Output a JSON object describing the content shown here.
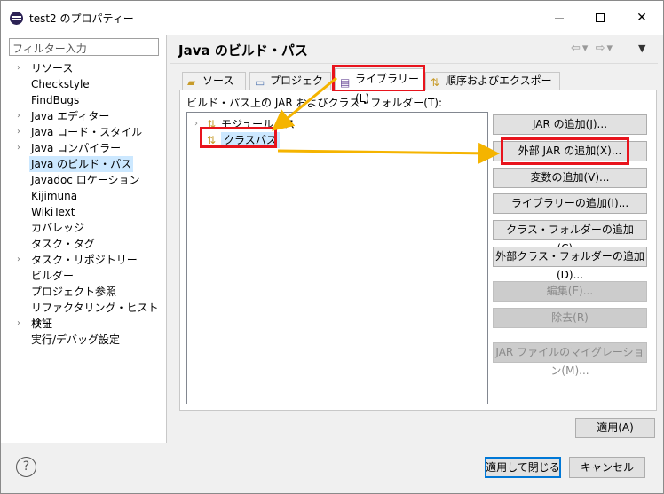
{
  "window": {
    "title": "test2 のプロパティー"
  },
  "filter": {
    "placeholder": "フィルター入力"
  },
  "sidebar": {
    "items": [
      {
        "label": "リソース",
        "expandable": true
      },
      {
        "label": "Checkstyle",
        "expandable": false
      },
      {
        "label": "FindBugs",
        "expandable": false
      },
      {
        "label": "Java エディター",
        "expandable": true
      },
      {
        "label": "Java コード・スタイル",
        "expandable": true
      },
      {
        "label": "Java コンパイラー",
        "expandable": true
      },
      {
        "label": "Java のビルド・パス",
        "expandable": false,
        "selected": true
      },
      {
        "label": "Javadoc ロケーション",
        "expandable": false
      },
      {
        "label": "Kijimuna",
        "expandable": false
      },
      {
        "label": "WikiText",
        "expandable": false
      },
      {
        "label": "カバレッジ",
        "expandable": false
      },
      {
        "label": "タスク・タグ",
        "expandable": false
      },
      {
        "label": "タスク・リポジトリー",
        "expandable": true
      },
      {
        "label": "ビルダー",
        "expandable": false
      },
      {
        "label": "プロジェクト参照",
        "expandable": false
      },
      {
        "label": "リファクタリング・ヒストリー",
        "expandable": false
      },
      {
        "label": "検証",
        "expandable": true
      },
      {
        "label": "実行/デバッグ設定",
        "expandable": false
      }
    ]
  },
  "main": {
    "title": "Java のビルド・パス",
    "tabs": [
      {
        "label": "ソース(S)"
      },
      {
        "label": "プロジェクト(P)"
      },
      {
        "label": "ライブラリー(L)",
        "active": true
      },
      {
        "label": "順序およびエクスポート(O)"
      }
    ],
    "build_path_label": "ビルド・パス上の JAR およびクラス・フォルダー(T):",
    "list": [
      {
        "label": "モジュールパス"
      },
      {
        "label": "クラスパス",
        "selected": true
      }
    ],
    "buttons": [
      {
        "label": "JAR の追加(J)...",
        "enabled": true
      },
      {
        "label": "外部 JAR の追加(X)...",
        "enabled": true
      },
      {
        "label": "変数の追加(V)...",
        "enabled": true
      },
      {
        "label": "ライブラリーの追加(I)...",
        "enabled": true
      },
      {
        "label": "クラス・フォルダーの追加(C)...",
        "enabled": true
      },
      {
        "label": "外部クラス・フォルダーの追加(D)...",
        "enabled": true
      },
      {
        "label": "編集(E)...",
        "enabled": false
      },
      {
        "label": "除去(R)",
        "enabled": false
      },
      {
        "label": "JAR ファイルのマイグレーション(M)...",
        "enabled": false
      }
    ],
    "apply_label": "適用(A)"
  },
  "footer": {
    "help_glyph": "?",
    "apply_close_label": "適用して閉じる",
    "cancel_label": "キャンセル"
  },
  "colors": {
    "highlight": "#e8141d",
    "arrow": "#f5b400",
    "selection": "#cce8ff"
  }
}
